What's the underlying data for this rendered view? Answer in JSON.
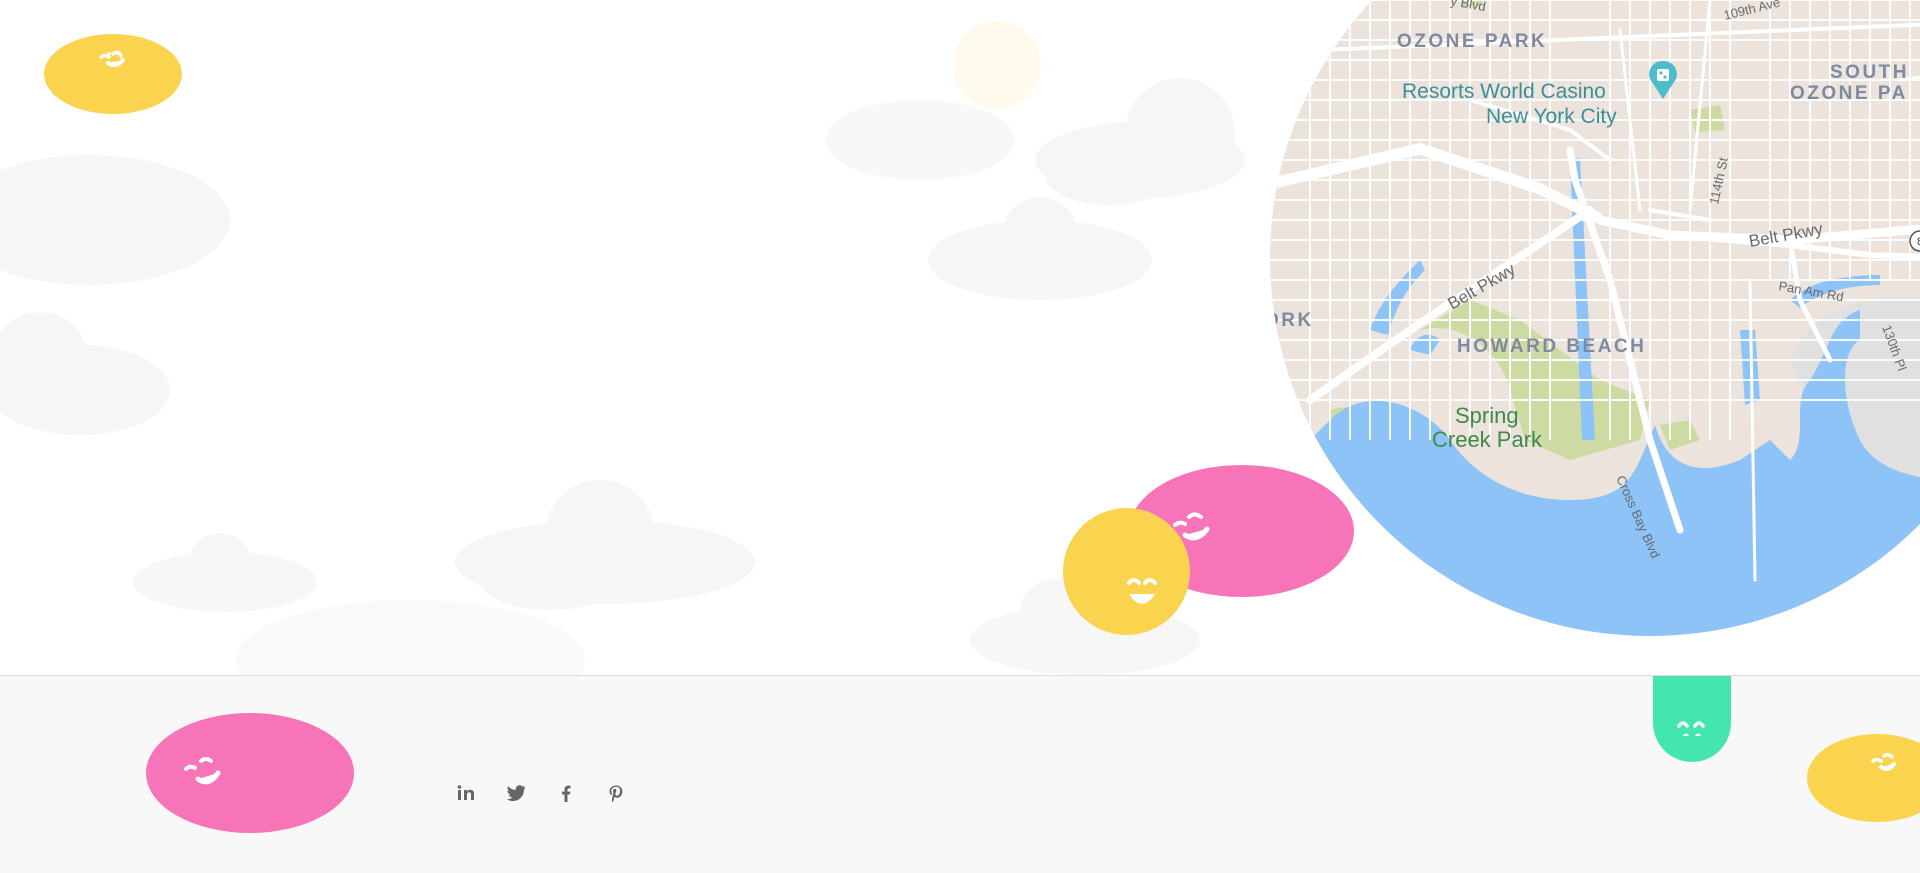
{
  "map": {
    "labels": {
      "ozone_park": "OZONE PARK",
      "south_ozone_park_1": "SOUTH",
      "south_ozone_park_2": "OZONE PA",
      "casino_1": "Resorts World Casino",
      "casino_2": "New York City",
      "belt_pkwy_left": "Belt Pkwy",
      "belt_pkwy_right": "Belt Pkwy",
      "pan_am": "Pan Am Rd",
      "st_114": "114th St",
      "pl_130": "130th Pl",
      "ave_109": "109th Ave",
      "blvd_top": "y Blvd",
      "ork": "ORK",
      "howard_beach": "HOWARD BEACH",
      "spring_creek_1": "Spring",
      "spring_creek_2": "Creek Park",
      "cross_bay": "Cross Bay Blvd",
      "route_shield": "8"
    },
    "colors": {
      "land": "#ebe3dc",
      "water": "#8ec3f8",
      "park": "#cddba3",
      "road": "#ffffff",
      "district_label": "#7e8aa0",
      "poi_label": "#3c8f9a",
      "park_label": "#3d8a4a"
    }
  },
  "social": {
    "items": [
      {
        "name": "linkedin",
        "icon": "linkedin-icon",
        "glyph": "in"
      },
      {
        "name": "twitter",
        "icon": "twitter-icon",
        "glyph": "bird"
      },
      {
        "name": "facebook",
        "icon": "facebook-icon",
        "glyph": "f"
      },
      {
        "name": "pinterest",
        "icon": "pinterest-icon",
        "glyph": "p"
      }
    ]
  },
  "decor": {
    "yellow": "#fad44e",
    "pink": "#f674b7",
    "green": "#44e6ad",
    "cloud": "#f6f6f6"
  }
}
